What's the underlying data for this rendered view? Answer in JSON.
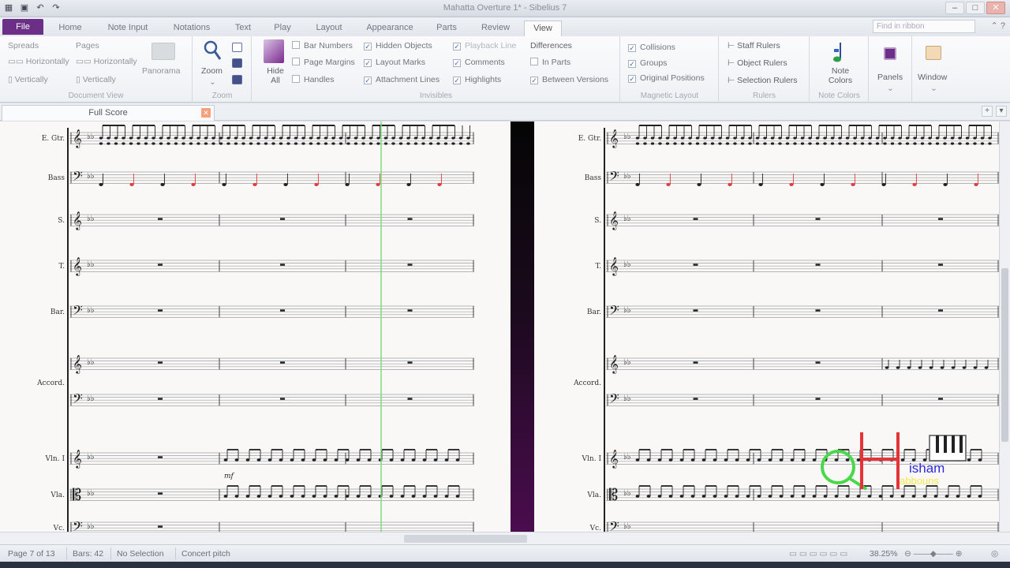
{
  "window": {
    "title": "Mahatta Overture 1* - Sibelius 7",
    "controls": [
      "–",
      "□",
      "✕"
    ]
  },
  "tabs": [
    "File",
    "Home",
    "Note Input",
    "Notations",
    "Text",
    "Play",
    "Layout",
    "Appearance",
    "Parts",
    "Review",
    "View"
  ],
  "active_tab": "View",
  "find_placeholder": "Find in ribbon",
  "ribbon": {
    "document_view": {
      "label": "Document View",
      "spreads": "Spreads",
      "pages": "Pages",
      "horizontally1": "Horizontally",
      "horizontally2": "Horizontally",
      "vertically1": "Vertically",
      "vertically2": "Vertically",
      "panorama": "Panorama"
    },
    "zoom": {
      "label": "Zoom",
      "zoom": "Zoom"
    },
    "invisibles": {
      "label": "Invisibles",
      "hide_all": "Hide All",
      "items": [
        {
          "label": "Bar Numbers",
          "checked": false
        },
        {
          "label": "Page Margins",
          "checked": false
        },
        {
          "label": "Handles",
          "checked": false
        },
        {
          "label": "Hidden Objects",
          "checked": true
        },
        {
          "label": "Layout Marks",
          "checked": true
        },
        {
          "label": "Attachment Lines",
          "checked": true
        },
        {
          "label": "Playback Line",
          "checked": true
        },
        {
          "label": "Comments",
          "checked": true
        },
        {
          "label": "Highlights",
          "checked": true
        }
      ],
      "differences": "Differences",
      "in_parts": {
        "label": "In Parts",
        "checked": false
      },
      "between_versions": {
        "label": "Between Versions",
        "checked": true
      }
    },
    "magnetic_layout": {
      "label": "Magnetic Layout",
      "items": [
        {
          "label": "Collisions",
          "checked": true
        },
        {
          "label": "Groups",
          "checked": true
        },
        {
          "label": "Original Positions",
          "checked": true
        }
      ]
    },
    "rulers": {
      "label": "Rulers",
      "items": [
        "Staff Rulers",
        "Object Rulers",
        "Selection Rulers"
      ]
    },
    "note_colors": {
      "label": "Note Colors",
      "button": "Note Colors"
    },
    "panels": "Panels",
    "window": "Window"
  },
  "doc_tab": "Full Score",
  "staves_left": [
    "E. Gtr.",
    "Bass",
    "S.",
    "T.",
    "Bar.",
    "Accord.",
    "Vln. I",
    "Vla.",
    "Vc."
  ],
  "staves_right": [
    "E. Gtr.",
    "Bass",
    "S.",
    "T.",
    "Bar.",
    "Accord.",
    "Vln. I",
    "Vla.",
    "Vc."
  ],
  "dynamic": "mf",
  "status": {
    "page": "Page 7 of 13",
    "bars": "Bars: 42",
    "selection": "No Selection",
    "pitch": "Concert pitch",
    "zoom": "38.25%"
  },
  "watermark": {
    "letters": "QH",
    "name": "isham",
    "surname": "abbouns"
  },
  "colors": {
    "file_tab": "#6c2f87",
    "playback_line": "#7ddc7d",
    "red_note": "#e33b3b",
    "page_divider": "#4a0c4e"
  }
}
